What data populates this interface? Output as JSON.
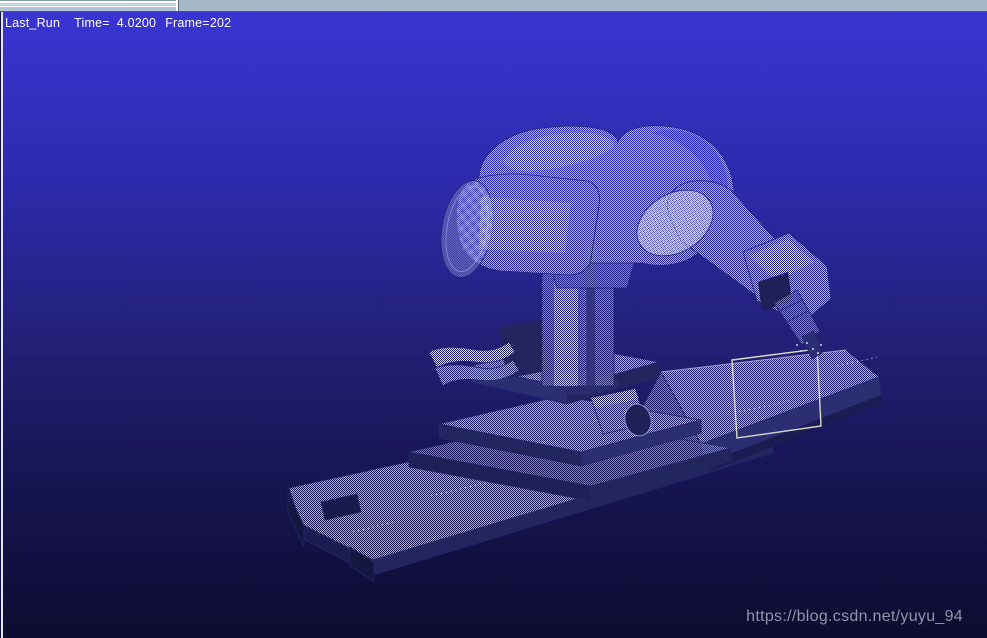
{
  "viewport": {
    "status_line": {
      "run": "Last_Run",
      "time_label": "Time=",
      "time_value": "4.0200",
      "frame_label": "Frame=",
      "frame_value": "202"
    },
    "watermark": "https://blog.csdn.net/yuyu_94",
    "colors": {
      "background_top": "#3a35d2",
      "background_bottom": "#0d0c30",
      "model_light": "#dde1f8",
      "model_mid": "#aab0e8",
      "model_dim": "#7a80cc",
      "model_dark": "#2c2e74",
      "selection_box": "#d8d8ca",
      "status_text": "#ffffff",
      "watermark_text": "#9295a8",
      "top_bar": "#a6b9c9"
    },
    "scene": {
      "objects": [
        "robot-arm",
        "spindle-tool",
        "pedestal-column",
        "xy-stage",
        "stage-motor",
        "gripper-fixture",
        "base-plate",
        "work-slab",
        "tool-path-rectangle"
      ]
    }
  }
}
